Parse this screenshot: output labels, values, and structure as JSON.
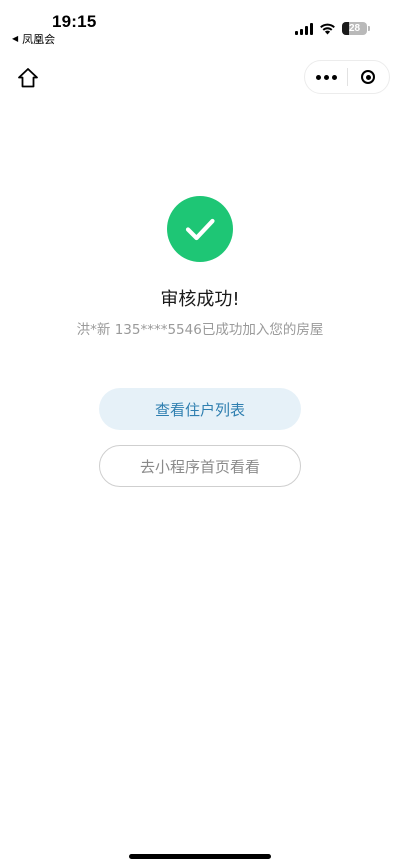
{
  "status_bar": {
    "time": "19:15",
    "back_app_label": "凤凰会",
    "battery_level": "28",
    "battery_fraction": 0.28
  },
  "nav": {
    "home_icon": "home-icon",
    "more_icon": "more-dots-icon",
    "close_icon": "mini-program-close-icon"
  },
  "result": {
    "icon": "check-circle-icon",
    "icon_color": "#1ec675",
    "title": "审核成功!",
    "description": "洪*新 135****5546已成功加入您的房屋"
  },
  "actions": {
    "primary_label": "查看住户列表",
    "secondary_label": "去小程序首页看看"
  },
  "colors": {
    "primary_button_bg": "#e6f1f8",
    "primary_button_text": "#2f7fb0",
    "secondary_button_border": "#cfcfcf"
  }
}
